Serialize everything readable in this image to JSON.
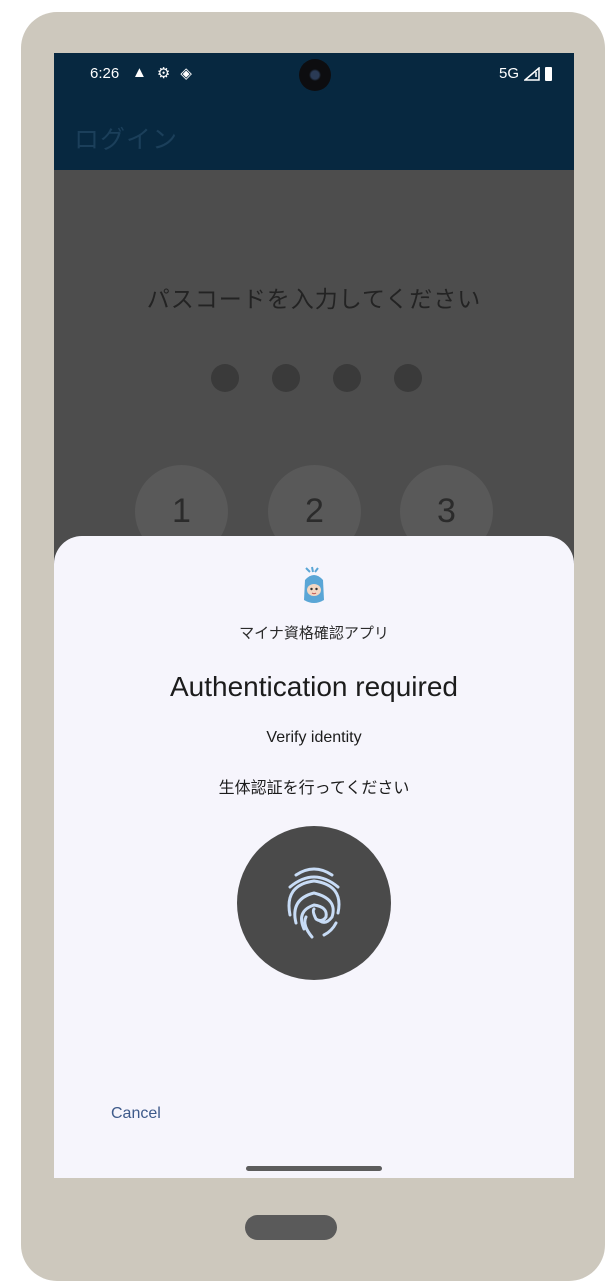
{
  "status_bar": {
    "time": "6:26",
    "left_icons": [
      "warning-icon",
      "settings-icon",
      "data-saver-icon"
    ],
    "network": "5G",
    "signal_icon": "signal-icon",
    "battery_icon": "battery-icon"
  },
  "app_bar": {
    "title": "ログイン"
  },
  "passcode": {
    "prompt": "パスコードを入力してください",
    "dots": 4,
    "keys": [
      "1",
      "2",
      "3"
    ]
  },
  "biometric_dialog": {
    "app_icon": "mascot-icon",
    "app_name": "マイナ資格確認アプリ",
    "title": "Authentication required",
    "subtitle": "Verify identity",
    "description": "生体認証を行ってください",
    "fingerprint_icon": "fingerprint-icon",
    "cancel_label": "Cancel"
  },
  "colors": {
    "device_frame": "#cdc8bd",
    "app_bar": "#072840",
    "scrim": "#4d4d4d",
    "sheet": "#f6f5fc",
    "fingerprint_circle": "#4a4a4a",
    "fingerprint_lines": "#c8dcf6",
    "cancel_text": "#3e5a8a"
  }
}
